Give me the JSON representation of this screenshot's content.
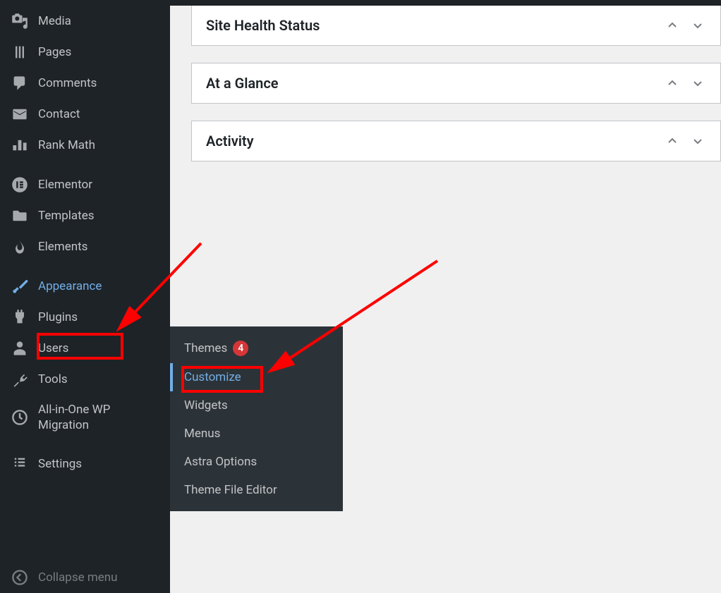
{
  "sidebar": {
    "items": [
      {
        "id": "media",
        "label": "Media",
        "icon": "media"
      },
      {
        "id": "pages",
        "label": "Pages",
        "icon": "pages"
      },
      {
        "id": "comments",
        "label": "Comments",
        "icon": "comments"
      },
      {
        "id": "contact",
        "label": "Contact",
        "icon": "contact"
      },
      {
        "id": "rankmath",
        "label": "Rank Math",
        "icon": "chart"
      },
      {
        "id": "elementor",
        "label": "Elementor",
        "icon": "elementor"
      },
      {
        "id": "templates",
        "label": "Templates",
        "icon": "folder"
      },
      {
        "id": "elements",
        "label": "Elements",
        "icon": "flame"
      },
      {
        "id": "appearance",
        "label": "Appearance",
        "icon": "brush",
        "active": true
      },
      {
        "id": "plugins",
        "label": "Plugins",
        "icon": "plugin"
      },
      {
        "id": "users",
        "label": "Users",
        "icon": "user"
      },
      {
        "id": "tools",
        "label": "Tools",
        "icon": "wrench"
      },
      {
        "id": "wpmigration",
        "label": "All-in-One WP Migration",
        "icon": "migration"
      },
      {
        "id": "settings",
        "label": "Settings",
        "icon": "settings"
      }
    ],
    "collapse_label": "Collapse menu"
  },
  "submenu": {
    "items": [
      {
        "id": "themes",
        "label": "Themes",
        "badge": "4"
      },
      {
        "id": "customize",
        "label": "Customize",
        "active": true
      },
      {
        "id": "widgets",
        "label": "Widgets"
      },
      {
        "id": "menus",
        "label": "Menus"
      },
      {
        "id": "astra",
        "label": "Astra Options"
      },
      {
        "id": "editor",
        "label": "Theme File Editor"
      }
    ]
  },
  "widgets": [
    {
      "id": "sitehealth",
      "title": "Site Health Status"
    },
    {
      "id": "glance",
      "title": "At a Glance"
    },
    {
      "id": "activity",
      "title": "Activity"
    }
  ]
}
